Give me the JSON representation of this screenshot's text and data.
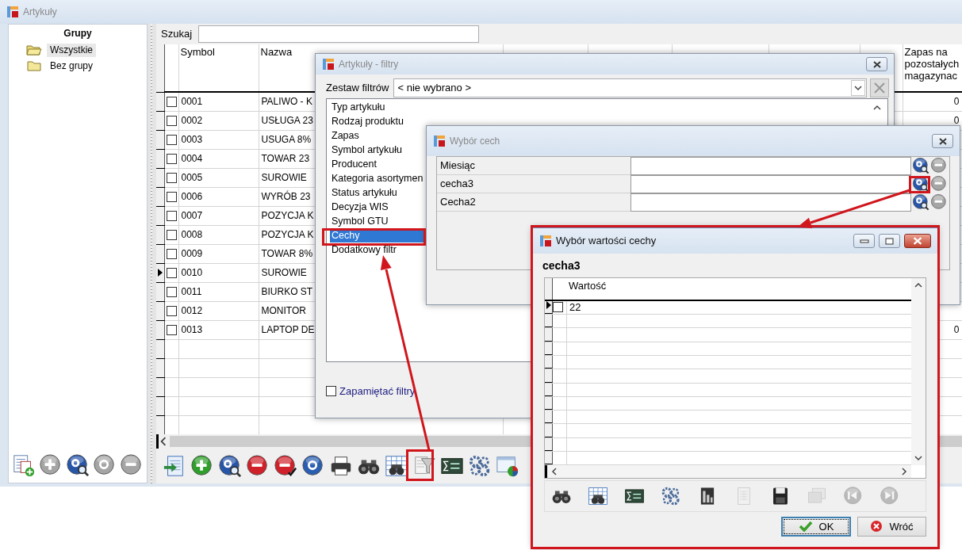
{
  "main_window": {
    "title": "Artykuły",
    "active": false
  },
  "groups": {
    "title": "Grupy",
    "items": [
      {
        "label": "Wszystkie",
        "selected": true
      },
      {
        "label": "Bez grupy",
        "selected": false
      }
    ],
    "toolbar": [
      {
        "kind": "document-add",
        "disabled": false
      },
      {
        "kind": "plus",
        "disabled": true
      },
      {
        "kind": "p-search",
        "disabled": false
      },
      {
        "kind": "p",
        "disabled": true
      },
      {
        "kind": "minus",
        "disabled": true
      }
    ]
  },
  "search": {
    "label": "Szukaj"
  },
  "table": {
    "columns": [
      "Symbol",
      "Nazwa",
      "Zapas na pozostałych magazynac"
    ],
    "rows": [
      {
        "symbol": "0001",
        "name": "PALIWO - K",
        "checked": false,
        "current": false,
        "remaining": "0"
      },
      {
        "symbol": "0002",
        "name": "USŁUGA 23",
        "checked": false,
        "current": false,
        "remaining": "0"
      },
      {
        "symbol": "0003",
        "name": "USUGA 8%",
        "checked": false,
        "current": false
      },
      {
        "symbol": "0004",
        "name": "TOWAR 23",
        "checked": false,
        "current": false
      },
      {
        "symbol": "0005",
        "name": "SUROWIE",
        "checked": false,
        "current": false
      },
      {
        "symbol": "0006",
        "name": "WYRÓB 23",
        "checked": false,
        "current": false
      },
      {
        "symbol": "0007",
        "name": "POZYCJA K",
        "checked": false,
        "current": false
      },
      {
        "symbol": "0008",
        "name": "POZYCJA K",
        "checked": false,
        "current": false
      },
      {
        "symbol": "0009",
        "name": "TOWAR 8%",
        "checked": false,
        "current": false
      },
      {
        "symbol": "0010",
        "name": "SUROWIE",
        "checked": false,
        "current": true
      },
      {
        "symbol": "0011",
        "name": "BIURKO ST",
        "checked": false,
        "current": false
      },
      {
        "symbol": "0012",
        "name": "MONITOR",
        "checked": false,
        "current": false
      },
      {
        "symbol": "0013",
        "name": "LAPTOP DE",
        "checked": false,
        "current": false,
        "remaining": "0"
      }
    ]
  },
  "toolbar": [
    {
      "kind": "export",
      "disabled": false
    },
    {
      "kind": "plus",
      "disabled": false
    },
    {
      "kind": "p-search",
      "disabled": false
    },
    {
      "kind": "minus",
      "disabled": false
    },
    {
      "kind": "minus-check",
      "disabled": false
    },
    {
      "kind": "p",
      "disabled": false
    },
    {
      "kind": "printer",
      "disabled": false
    },
    {
      "kind": "binoculars",
      "disabled": false
    },
    {
      "kind": "table-binoculars",
      "disabled": false
    },
    {
      "kind": "filter",
      "disabled": false
    },
    {
      "kind": "sum",
      "disabled": false
    },
    {
      "kind": "gears",
      "disabled": false
    },
    {
      "kind": "window-chart",
      "disabled": false
    }
  ],
  "filter_dialog": {
    "title": "Artykuły - filtry",
    "active": false,
    "set_label": "Zestaw filtrów",
    "set_value": "< nie wybrano >",
    "items": [
      {
        "label": "Typ artykułu",
        "selected": false
      },
      {
        "label": "Rodzaj produktu",
        "selected": false
      },
      {
        "label": "Zapas",
        "selected": false
      },
      {
        "label": "Symbol artykułu",
        "selected": false
      },
      {
        "label": "Producent",
        "selected": false
      },
      {
        "label": "Kategoria asortymen",
        "selected": false
      },
      {
        "label": "Status artykułu",
        "selected": false
      },
      {
        "label": "Decyzja WIS",
        "selected": false
      },
      {
        "label": "Symbol GTU",
        "selected": false
      },
      {
        "label": "Cechy",
        "selected": true
      },
      {
        "label": "Dodatkowy filtr",
        "selected": false
      }
    ],
    "remember": {
      "label": "Zapamiętać filtry",
      "checked": false
    }
  },
  "features_dialog": {
    "title": "Wybór cech",
    "active": false,
    "features": [
      "Miesiąc",
      "cecha3",
      "Cecha2"
    ]
  },
  "value_dialog": {
    "title": "Wybór wartości cechy",
    "active": true,
    "feature": "cecha3",
    "column": "Wartość",
    "rows": [
      {
        "value": "22",
        "checked": false,
        "current": true
      }
    ],
    "toolbar": [
      {
        "kind": "binoculars",
        "disabled": false
      },
      {
        "kind": "table-binoculars",
        "disabled": false
      },
      {
        "kind": "sum",
        "disabled": false
      },
      {
        "kind": "gears",
        "disabled": false
      },
      {
        "kind": "chart",
        "disabled": false
      },
      {
        "kind": "sheet",
        "disabled": true
      },
      {
        "kind": "save",
        "disabled": false
      },
      {
        "kind": "windows",
        "disabled": true
      },
      {
        "kind": "first",
        "disabled": true
      },
      {
        "kind": "last",
        "disabled": true
      }
    ],
    "buttons": [
      {
        "label": "OK",
        "kind": "ok",
        "default": true
      },
      {
        "label": "Wróć",
        "kind": "cancel",
        "default": false
      }
    ]
  }
}
